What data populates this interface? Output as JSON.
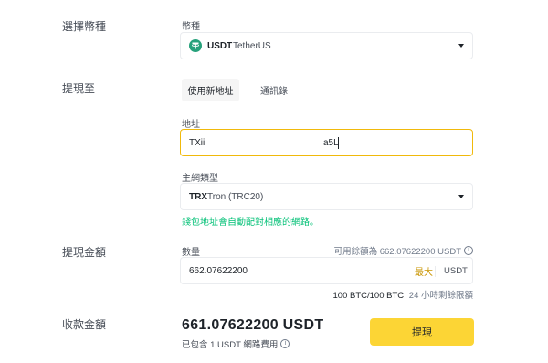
{
  "colors": {
    "accent_green": "#02c076",
    "accent_yellow": "#fcd535",
    "focus_border": "#f0b90b",
    "max_gold": "#c99400",
    "tether_green": "#26a17b"
  },
  "coin_section": {
    "label": "選擇幣種",
    "field_label": "幣種",
    "selected": {
      "icon": "tether-icon",
      "symbol": "USDT",
      "name": "TetherUS"
    }
  },
  "withdraw_to": {
    "label": "提現至",
    "tabs": [
      {
        "label": "使用新地址",
        "active": true
      },
      {
        "label": "通訊錄",
        "active": false
      }
    ],
    "address_label": "地址",
    "address_prefix": "TXii",
    "address_suffix": "a5L",
    "network_label": "主網類型",
    "network": {
      "symbol": "TRX",
      "name": "Tron (TRC20)"
    },
    "network_notice": "錢包地址會自動配對相應的網路。"
  },
  "amount_section": {
    "label": "提現金額",
    "field_label": "數量",
    "available_text": "可用餘額為 662.07622200 USDT",
    "amount_value": "662.07622200",
    "max_label": "最大",
    "unit": "USDT",
    "limit": "100 BTC/100 BTC",
    "limit_note": "24 小時剩餘限額"
  },
  "receive_section": {
    "label": "收款金額",
    "amount": "661.07622200 USDT",
    "fee_note": "已包含 1 USDT 網路費用",
    "submit_label": "提現"
  }
}
